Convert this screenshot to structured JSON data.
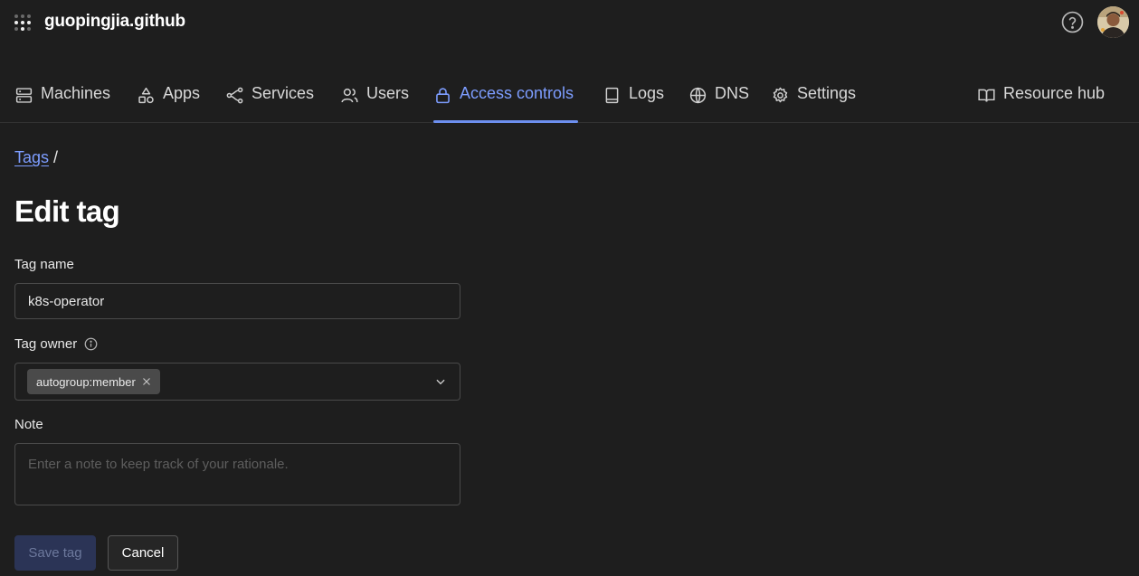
{
  "header": {
    "tailnet_name": "guopingjia.github",
    "help_icon": "help-circle-icon",
    "avatar_icon": "user-avatar"
  },
  "nav": {
    "items": [
      {
        "label": "Machines",
        "icon": "machines-icon"
      },
      {
        "label": "Apps",
        "icon": "apps-icon"
      },
      {
        "label": "Services",
        "icon": "services-icon"
      },
      {
        "label": "Users",
        "icon": "users-icon"
      },
      {
        "label": "Access controls",
        "icon": "lock-icon",
        "active": true
      },
      {
        "label": "Logs",
        "icon": "book-icon"
      },
      {
        "label": "DNS",
        "icon": "globe-icon"
      },
      {
        "label": "Settings",
        "icon": "gear-icon"
      }
    ],
    "resource_hub": {
      "label": "Resource hub",
      "icon": "open-book-icon"
    }
  },
  "breadcrumb": {
    "link": "Tags",
    "separator": "/"
  },
  "page": {
    "title": "Edit tag"
  },
  "form": {
    "tag_name": {
      "label": "Tag name",
      "value": "k8s-operator"
    },
    "tag_owner": {
      "label": "Tag owner",
      "chip": "autogroup:member",
      "info_icon": "info-icon"
    },
    "note": {
      "label": "Note",
      "placeholder": "Enter a note to keep track of your rationale.",
      "value": ""
    },
    "save_label": "Save tag",
    "cancel_label": "Cancel"
  },
  "colors": {
    "background": "#1e1e1e",
    "accent": "#7d9dff",
    "border": "#4a4a4a",
    "save_disabled_bg": "#2b3456"
  }
}
